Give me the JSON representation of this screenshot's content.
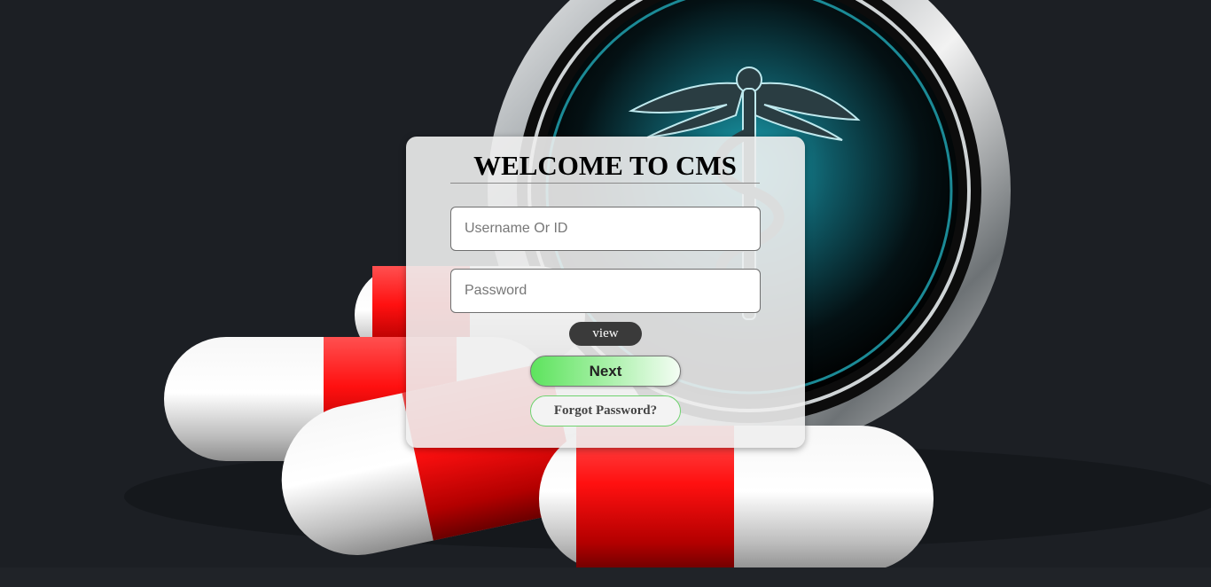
{
  "login": {
    "title": "WELCOME TO CMS",
    "username_placeholder": "Username Or ID",
    "password_placeholder": "Password",
    "view_label": "view",
    "next_label": "Next",
    "forgot_label": "Forgot Password?"
  },
  "colors": {
    "background": "#1c1f24",
    "card": "#eeeeee",
    "next_gradient_start": "#5de35d",
    "next_gradient_end": "#f4fdf4",
    "view_button": "#3a3a3a",
    "forgot_border": "#6fd36f"
  },
  "background_image": {
    "icons": [
      "caduceus-icon",
      "capsule-pill"
    ]
  }
}
